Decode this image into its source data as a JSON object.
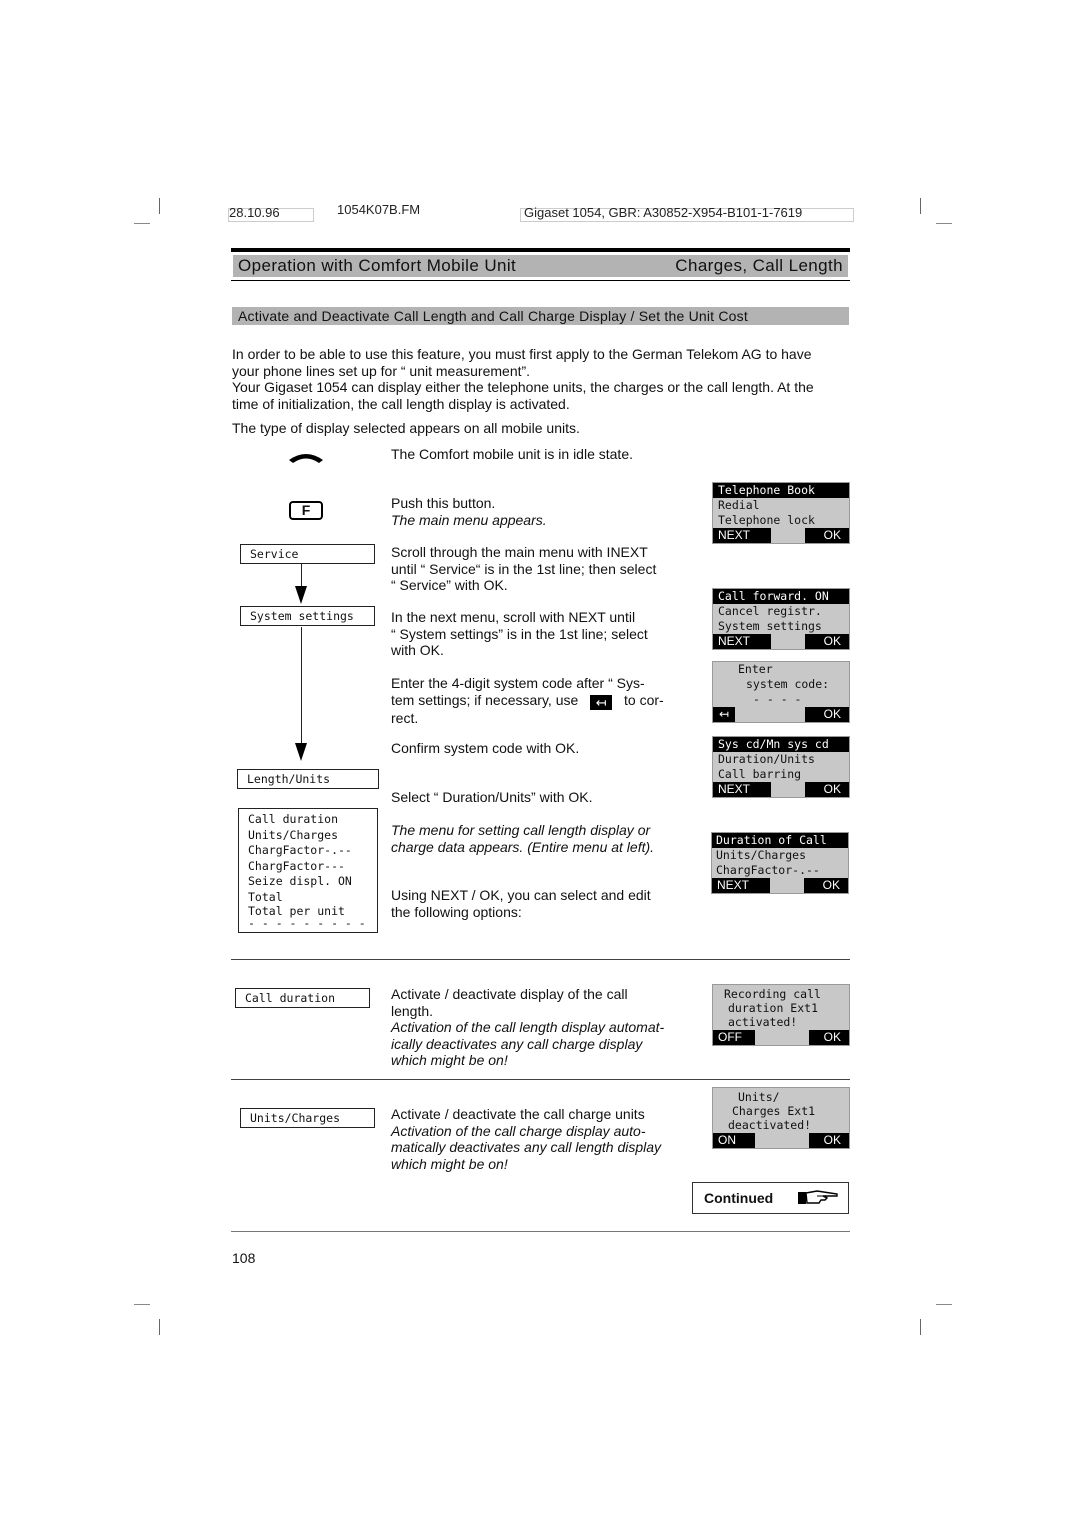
{
  "header": {
    "date": "28.10.96",
    "filename": "1054K07B.FM",
    "product_ref": "Gigaset 1054, GBR: A30852-X954-B101-1-7619"
  },
  "title_bar": {
    "left": "Operation with Comfort Mobile Unit",
    "right": "Charges, Call Length"
  },
  "section_heading": "Activate and Deactivate Call Length and Call Charge Display / Set the Unit Cost",
  "intro": {
    "p1_line1": "In order to be able to use this feature, you must first apply to the German Telekom AG to have",
    "p1_line2": "your phone lines set up for “ unit measurement”.",
    "p2_line1": "Your Gigaset 1054 can display either the telephone units, the charges or the call length. At the",
    "p2_line2": "time of initialization, the call length display is activated.",
    "p3": "The type of display selected appears on all mobile units."
  },
  "icons": {
    "handset": "handset-icon",
    "f_key": "F",
    "backspace": "↤",
    "pointing_hand": "pointing-hand-icon"
  },
  "steps": {
    "idle": "The Comfort mobile unit is in idle state.",
    "push_line1": "Push this button.",
    "push_line2": "The main menu appears.",
    "scroll_l1": "Scroll through the main menu with INEXT",
    "scroll_l2": "until “ Service“  is in the 1st line; then select",
    "scroll_l3": "“ Service”  with OK.",
    "next_l1": "In the next menu, scroll with NEXT until",
    "next_l2": "“ System settings”  is in the 1st line;  select",
    "next_l3": "with OK.",
    "enter_l1": "Enter the 4-digit system code after “ Sys-",
    "enter_l2a": "tem settings; if necessary, use",
    "enter_l2b": "to cor-",
    "enter_l3": "rect.",
    "confirm": "Confirm system code with OK.",
    "select": "Select “ Duration/Units”  with OK.",
    "menu_l1": "The menu for setting call length display or",
    "menu_l2": "charge data appears. (Entire menu at left).",
    "using_l1": "Using NEXT / OK, you can select and edit",
    "using_l2": "the following options:"
  },
  "flow": {
    "service": "Service",
    "system_settings": "System settings",
    "length_units": "Length/Units",
    "menu_items": [
      "Call duration",
      "Units/Charges",
      "ChargFactor-.--",
      "ChargFactor---",
      "Seize displ. ON",
      "Total",
      "Total per unit",
      "- - - - - - - - -"
    ]
  },
  "displays": {
    "main_menu": {
      "lines": [
        "Telephone Book",
        "Redial",
        "Telephone lock"
      ],
      "left_key": "NEXT",
      "right_key": "OK"
    },
    "service_menu": {
      "lines": [
        "Call forward. ON",
        "Cancel registr.",
        "System settings"
      ],
      "left_key": "NEXT",
      "right_key": "OK"
    },
    "system_code": {
      "lines": [
        "Enter",
        "system code:",
        "- - - -"
      ],
      "left_key": "↤",
      "right_key": "OK"
    },
    "system_menu": {
      "lines": [
        "Sys cd/Mn sys cd",
        "Duration/Units",
        "Call barring"
      ],
      "left_key": "NEXT",
      "right_key": "OK"
    },
    "duration_menu": {
      "lines": [
        "Duration of Call",
        "Units/Charges",
        "ChargFactor-.--"
      ],
      "left_key": "NEXT",
      "right_key": "OK"
    },
    "call_duration_msg": {
      "lines": [
        "Recording call",
        "duration Ext1",
        "activated!"
      ],
      "left_key": "OFF",
      "right_key": "OK"
    },
    "units_msg": {
      "lines": [
        "Units/",
        "Charges Ext1",
        "deactivated!"
      ],
      "left_key": "ON",
      "right_key": "OK"
    }
  },
  "options": {
    "call_duration": {
      "label": "Call duration",
      "l1": "Activate / deactivate display of the call",
      "l2": "length.",
      "l3": "Activation of the call length display automat-",
      "l4": "ically deactivates any call charge display",
      "l5": "which might be on!"
    },
    "units_charges": {
      "label": "Units/Charges",
      "l1": "Activate / deactivate the call charge units",
      "l2": "Activation of the call charge display auto-",
      "l3": "matically deactivates any call length display",
      "l4": "which might be on!"
    }
  },
  "continued": "Continued",
  "page_number": "108"
}
